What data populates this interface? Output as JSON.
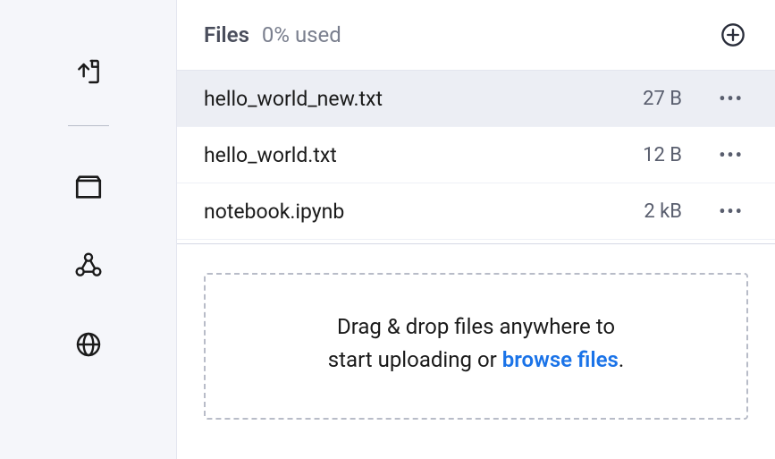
{
  "sidebar": {
    "icons": [
      {
        "name": "upload-file-icon"
      },
      {
        "name": "folder-icon"
      },
      {
        "name": "share-nodes-icon"
      },
      {
        "name": "globe-icon"
      }
    ]
  },
  "header": {
    "title": "Files",
    "usage_text": "0% used"
  },
  "files": [
    {
      "name": "hello_world_new.txt",
      "size": "27 B",
      "selected": true
    },
    {
      "name": "hello_world.txt",
      "size": "12 B",
      "selected": false
    },
    {
      "name": "notebook.ipynb",
      "size": "2 kB",
      "selected": false
    }
  ],
  "dropzone": {
    "line1": "Drag & drop files anywhere to",
    "line2_prefix": "start uploading or ",
    "browse_label": "browse files",
    "suffix": "."
  }
}
